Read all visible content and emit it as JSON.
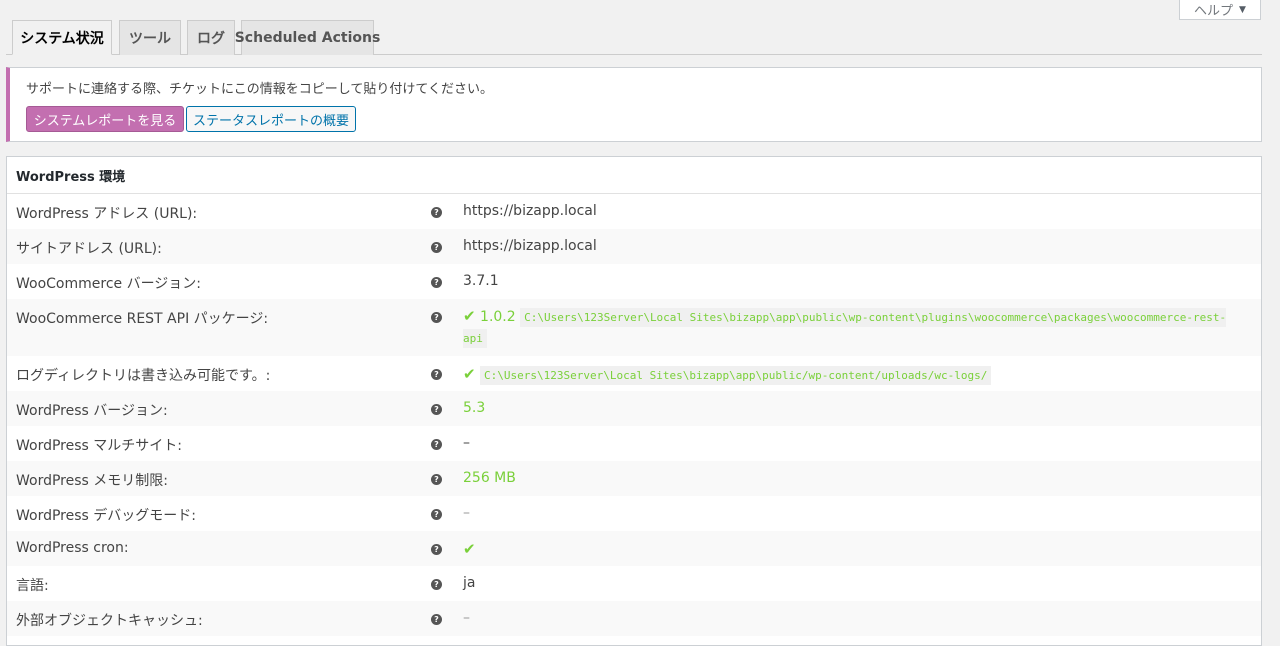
{
  "help_tab": {
    "label": "ヘルプ",
    "arrow": "▼"
  },
  "tabs": [
    {
      "label": "システム状況",
      "active": true
    },
    {
      "label": "ツール",
      "active": false
    },
    {
      "label": "ログ",
      "active": false
    },
    {
      "label": "Scheduled Actions",
      "active": false
    }
  ],
  "notice": {
    "text": "サポートに連絡する際、チケットにこの情報をコピーして貼り付けてください。",
    "primary_button": "システムレポートを見る",
    "secondary_button": "ステータスレポートの概要"
  },
  "table": {
    "title": "WordPress 環境",
    "help_glyph": "?",
    "rows": [
      {
        "label": "WordPress アドレス (URL):",
        "value": "https://bizapp.local"
      },
      {
        "label": "サイトアドレス (URL):",
        "value": "https://bizapp.local"
      },
      {
        "label": "WooCommerce バージョン:",
        "value": "3.7.1"
      },
      {
        "label": "WooCommerce REST API パッケージ:",
        "check": "✔",
        "version": "1.0.2",
        "path": "C:\\Users\\123Server\\Local Sites\\bizapp\\app\\public\\wp-content\\plugins\\woocommerce\\packages\\woocommerce-rest-api"
      },
      {
        "label": "ログディレクトリは書き込み可能です。:",
        "check": "✔",
        "path": "C:\\Users\\123Server\\Local Sites\\bizapp\\app\\public/wp-content/uploads/wc-logs/"
      },
      {
        "label": "WordPress バージョン:",
        "value": "5.3"
      },
      {
        "label": "WordPress マルチサイト:",
        "value": "–"
      },
      {
        "label": "WordPress メモリ制限:",
        "value": "256 MB"
      },
      {
        "label": "WordPress デバッグモード:",
        "value": "–"
      },
      {
        "label": "WordPress cron:",
        "check": "✔"
      },
      {
        "label": "言語:",
        "value": "ja"
      },
      {
        "label": "外部オブジェクトキャッシュ:",
        "value": "–"
      }
    ]
  },
  "colors": {
    "accent_purple": "#c36fb0",
    "link_blue": "#0073aa",
    "success_green": "#7ad03a"
  }
}
